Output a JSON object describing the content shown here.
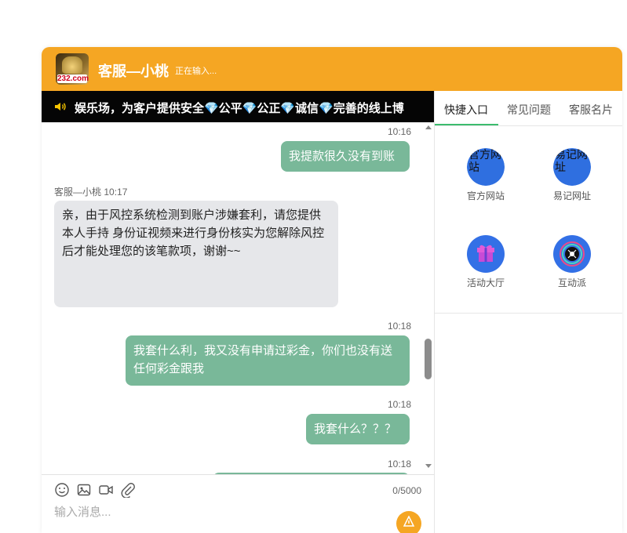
{
  "header": {
    "logo_text": "232.com",
    "agent_name": "客服—小桃",
    "status": "正在输入..."
  },
  "marquee": {
    "text": "娱乐场，为客户提供安全💎公平💎公正💎诚信💎完善的线上博"
  },
  "messages": [
    {
      "time": "10:16",
      "text": "我提款很久没有到账"
    },
    {
      "sender": "客服—小桃",
      "time": "10:17",
      "text": "亲，由于风控系统检测到账户涉嫌套利，请您提供本人手持 身份证视频来进行身份核实为您解除风控后才能处理您的该笔款项，谢谢~~"
    },
    {
      "time": "10:18",
      "text": "我套什么利，我又没有申请过彩金，你们也没有送任何彩金跟我"
    },
    {
      "time": "10:18",
      "text": "我套什么？？？"
    },
    {
      "time": "10:18",
      "text": ""
    }
  ],
  "composer": {
    "counter": "0/5000",
    "placeholder": "输入消息..."
  },
  "side": {
    "tabs": [
      "快捷入口",
      "常见问题",
      "客服名片"
    ],
    "quick": [
      {
        "label": "官方网站",
        "alt": "官方网站",
        "icon": "globe-image-icon"
      },
      {
        "label": "易记网址",
        "alt": "易记网址",
        "icon": "link-image-icon"
      },
      {
        "label": "活动大厅",
        "icon": "gift-icon"
      },
      {
        "label": "互动派",
        "icon": "camera-lens-icon"
      }
    ]
  },
  "colors": {
    "header": "#f5a623",
    "outgoing": "#79b899",
    "incoming": "#e6e7ea",
    "tab_active": "#3cbc6e"
  }
}
